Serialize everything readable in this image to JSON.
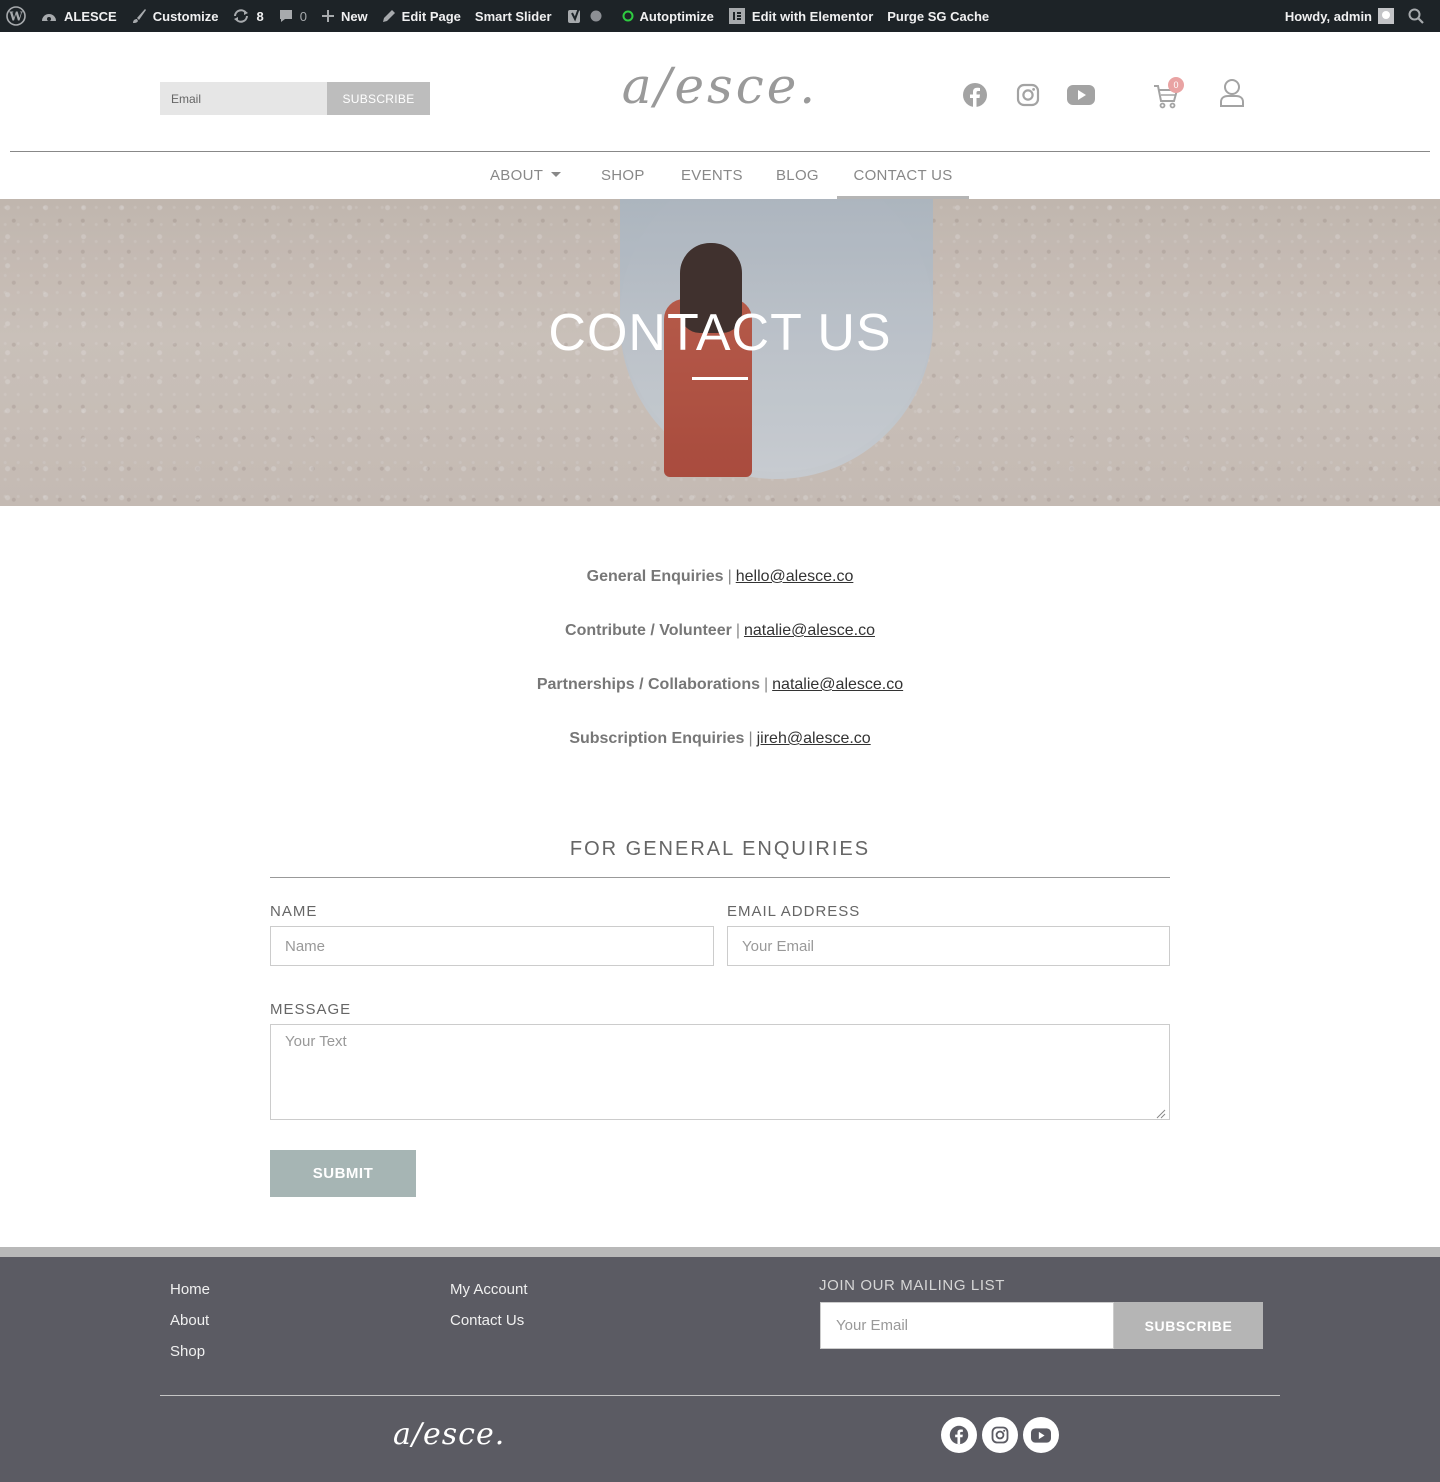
{
  "admin_bar": {
    "site_name": "ALESCE",
    "customize": "Customize",
    "updates_count": "8",
    "comments_count": "0",
    "new_label": "New",
    "edit_page": "Edit Page",
    "smart_slider": "Smart Slider",
    "autoptimize": "Autoptimize",
    "elementor": "Edit with Elementor",
    "purge": "Purge SG Cache",
    "howdy": "Howdy, admin"
  },
  "header": {
    "subscribe_placeholder": "Email",
    "subscribe_button": "SUBSCRIBE",
    "logo_text": "a/esce.",
    "cart_count": "0",
    "social_icons": [
      "facebook-icon",
      "instagram-icon",
      "youtube-icon"
    ]
  },
  "nav": {
    "items": [
      {
        "label": "ABOUT",
        "has_dropdown": true
      },
      {
        "label": "SHOP"
      },
      {
        "label": "EVENTS"
      },
      {
        "label": "BLOG"
      },
      {
        "label": "CONTACT US",
        "active": true
      }
    ]
  },
  "hero": {
    "title": "CONTACT US"
  },
  "contacts": [
    {
      "label": "General Enquiries",
      "separator": "|",
      "email": "hello@alesce.co"
    },
    {
      "label": "Contribute / Volunteer",
      "separator": "|",
      "email": "natalie@alesce.co"
    },
    {
      "label": "Partnerships / Collaborations",
      "separator": "|",
      "email": "natalie@alesce.co"
    },
    {
      "label": "Subscription Enquiries",
      "separator": "|",
      "email": "jireh@alesce.co"
    }
  ],
  "form": {
    "title": "FOR GENERAL ENQUIRIES",
    "name_label": "NAME",
    "name_placeholder": "Name",
    "email_label": "EMAIL ADDRESS",
    "email_placeholder": "Your Email",
    "message_label": "MESSAGE",
    "message_placeholder": "Your Text",
    "submit": "SUBMIT"
  },
  "footer": {
    "col1": [
      "Home",
      "About",
      "Shop"
    ],
    "col2": [
      "My Account",
      "Contact Us"
    ],
    "mailing_title": "JOIN OUR MAILING LIST",
    "mailing_placeholder": "Your Email",
    "mailing_button": "SUBSCRIBE",
    "logo_text": "a/esce.",
    "social_icons": [
      "facebook-icon",
      "instagram-icon",
      "youtube-icon"
    ]
  },
  "colors": {
    "admin_bar_bg": "#1d2327",
    "footer_bg": "#5b5b63",
    "submit_bg": "#a6b5b4",
    "cart_badge": "#e9a3a3"
  }
}
